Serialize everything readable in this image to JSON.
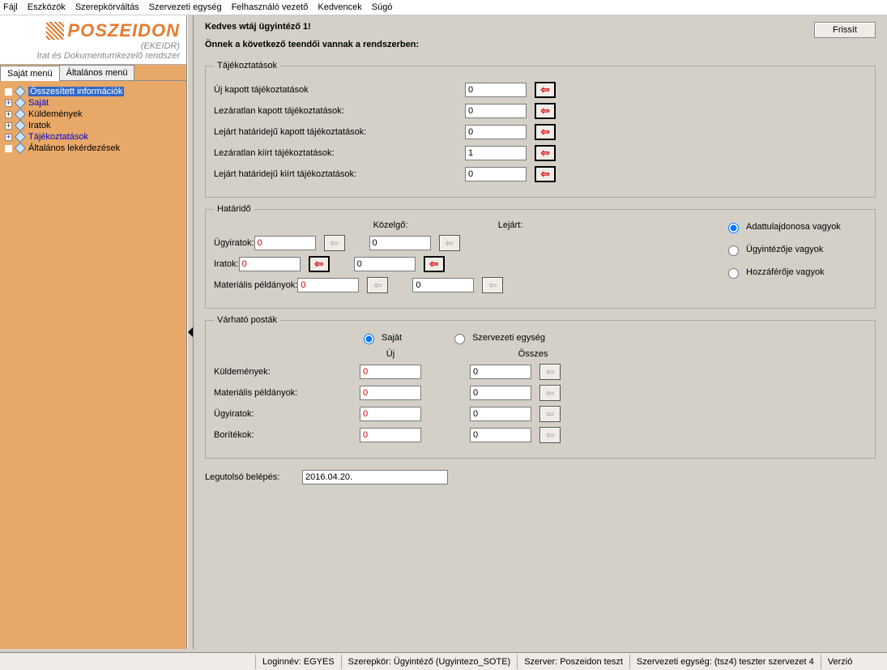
{
  "menu": [
    "Fájl",
    "Eszközök",
    "Szerepkörváltás",
    "Szervezeti egység",
    "Felhasználó vezető",
    "Kedvencek",
    "Súgó"
  ],
  "logo": {
    "main": "POSZEIDON",
    "sub1": "(EKEIDR)",
    "sub2": "Irat és Dokumentumkezelő rendszer"
  },
  "tabs": {
    "active": "Saját menü",
    "inactive": "Általános menü"
  },
  "tree": [
    {
      "label": "Összesített információk",
      "sel": true,
      "link": true,
      "exp": ""
    },
    {
      "label": "Saját",
      "link": true,
      "exp": "+"
    },
    {
      "label": "Küldemények",
      "exp": "+"
    },
    {
      "label": "Iratok",
      "exp": "+"
    },
    {
      "label": "Tájékoztatások",
      "link": true,
      "exp": "+"
    },
    {
      "label": "Általános lekérdezések",
      "exp": ""
    }
  ],
  "header": {
    "greeting": "Kedves wtáj ügyintéző 1!",
    "sub": "Önnek a következő teendői vannak a rendszerben:",
    "refresh": "Frissít"
  },
  "taj": {
    "legend": "Tájékoztatások",
    "rows": [
      {
        "label": "Új kapott tájékoztatások",
        "val": "0"
      },
      {
        "label": "Lezáratlan kapott tájékoztatások:",
        "val": "0"
      },
      {
        "label": "Lejárt határidejű kapott tájékoztatások:",
        "val": "0"
      },
      {
        "label": "Lezáratlan kiírt tájékoztatások:",
        "val": "1"
      },
      {
        "label": "Lejárt határidejű kiírt tájékoztatások:",
        "val": "0"
      }
    ]
  },
  "hat": {
    "legend": "Határidő",
    "col1": "Közelgő:",
    "col2": "Lejárt:",
    "rows": [
      {
        "label": "Ügyiratok:",
        "v1": "0",
        "v2": "0",
        "b1": "grey",
        "b2": "grey"
      },
      {
        "label": "Iratok:",
        "v1": "0",
        "v2": "0",
        "b1": "red",
        "b2": "red"
      },
      {
        "label": "Materiális példányok:",
        "v1": "0",
        "v2": "0",
        "b1": "grey",
        "b2": "grey"
      }
    ],
    "radios": [
      "Adattulajdonosa vagyok",
      "Ügyintézője vagyok",
      "Hozzáférője vagyok"
    ]
  },
  "varh": {
    "legend": "Várható posták",
    "r1": "Saját",
    "r2": "Szervezeti egység",
    "col1": "Új",
    "col2": "Összes",
    "rows": [
      {
        "label": "Küldemények:",
        "v1": "0",
        "v2": "0"
      },
      {
        "label": "Materiális példányok:",
        "v1": "0",
        "v2": "0"
      },
      {
        "label": "Ügyiratok:",
        "v1": "0",
        "v2": "0"
      },
      {
        "label": "Borítékok:",
        "v1": "0",
        "v2": "0"
      }
    ]
  },
  "lastlogin": {
    "label": "Legutolsó belépés:",
    "val": "2016.04.20."
  },
  "status": {
    "login": "Loginnév: EGYES",
    "role": "Szerepkör: Ügyintéző (Ugyintezo_SOTE)",
    "server": "Szerver: Poszeidon teszt",
    "org": "Szervezeti egység: (tsz4) teszter szervezet 4",
    "ver": "Verzió"
  }
}
